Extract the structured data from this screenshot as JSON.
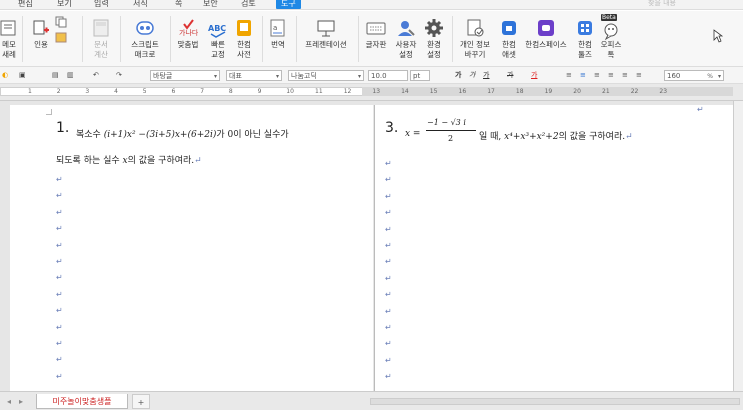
{
  "menu": {
    "items": [
      "편집",
      "보기",
      "입력",
      "서식",
      "쪽",
      "보안",
      "검토",
      "도구"
    ],
    "active_index": 7,
    "search_hint": "찾을 내용"
  },
  "ribbon": {
    "groups": [
      {
        "label": "메모\n새례",
        "key": "memo"
      },
      {
        "label": "인용",
        "key": "cite"
      },
      {
        "label": "",
        "key": "copy"
      },
      {
        "label": "문서\n계산",
        "key": "calc"
      },
      {
        "label": "스크립트\n매크로",
        "key": "script"
      },
      {
        "label": "맞춤법",
        "key": "spell"
      },
      {
        "label": "빠른\n교정",
        "key": "quick"
      },
      {
        "label": "한컴\n사전",
        "key": "dict"
      },
      {
        "label": "번역",
        "key": "translate"
      },
      {
        "label": "프레젠테이션",
        "key": "present"
      },
      {
        "label": "글자판",
        "key": "keyboard"
      },
      {
        "label": "사용자\n설정",
        "key": "user"
      },
      {
        "label": "환경\n설정",
        "key": "env"
      },
      {
        "label": "개인 정보\n바꾸기",
        "key": "privacy"
      },
      {
        "label": "한컴\n애셋",
        "key": "asset"
      },
      {
        "label": "한컴스페이스",
        "key": "space"
      },
      {
        "label": "한컴\n툴즈",
        "key": "tools"
      },
      {
        "label": "오피스\n톡",
        "key": "talk"
      }
    ],
    "beta_badge": "Beta"
  },
  "format": {
    "style": "바탕글",
    "alias": "대표",
    "font": "나눔고딕",
    "size": "10.0",
    "unit": "pt",
    "bold": "가",
    "italic": "가",
    "underline": "가",
    "strike": "가",
    "color_char": "가",
    "zoom": "160",
    "zoom_unit": "%"
  },
  "ruler": {
    "ticks": [
      "1",
      "2",
      "3",
      "4",
      "5",
      "6",
      "7",
      "8",
      "9",
      "10",
      "11",
      "12",
      "13",
      "14",
      "15",
      "16",
      "17",
      "18",
      "19",
      "20",
      "21",
      "22",
      "23"
    ]
  },
  "doc": {
    "q1": {
      "num": "1.",
      "line1_pre": "복소수 ",
      "line1_math": "(i+1)x² −(3i+5)x+(6+2i)",
      "line1_post": "가 0이 아닌 실수가",
      "line2_pre": "되도록 하는 실수 ",
      "line2_math": "x",
      "line2_post": "의 값을 구하여라."
    },
    "q3": {
      "num": "3.",
      "math_pre": "x =",
      "frac_num": "−1 − √3 i",
      "frac_den": "2",
      "mid": "일 때, ",
      "math_expr": "x⁴+x³+x²+2",
      "post": "의 값을 구하여라."
    },
    "return_mark": "↵"
  },
  "tabs": {
    "sheet_name": "미주놀이맞춤생플",
    "add": "+"
  }
}
